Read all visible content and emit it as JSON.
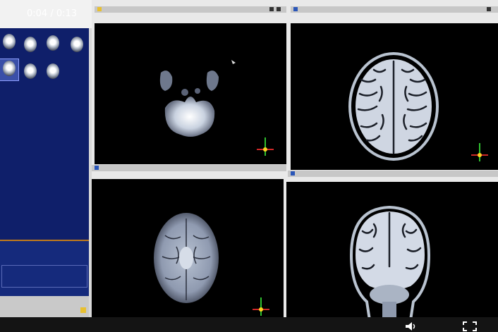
{
  "sidebar": {
    "title": "",
    "subtitle": "",
    "thumbnails": [
      {
        "label": "",
        "selected": false
      },
      {
        "label": "",
        "selected": false
      },
      {
        "label": "",
        "selected": false
      },
      {
        "label": "",
        "selected": false
      },
      {
        "label": "",
        "selected": true
      },
      {
        "label": "",
        "selected": false
      },
      {
        "label": "",
        "selected": false
      }
    ],
    "messages": {
      "line1": "",
      "line2": "",
      "line3": "",
      "box_text": ""
    }
  },
  "viewports": [
    {
      "id": "v1",
      "name": "axial-dwi-lower",
      "tag": ""
    },
    {
      "id": "v2",
      "name": "axial-t1-upper",
      "tag": ""
    },
    {
      "id": "v3",
      "name": "axial-dwi-mid",
      "tag": ""
    },
    {
      "id": "v4",
      "name": "coronal-t1",
      "tag": ""
    }
  ],
  "player": {
    "time": "0:04 / 0:13"
  },
  "colors": {
    "series_panel": "#0f1f6a",
    "viewport_bg": "#000000",
    "tag_blue": "#2a56b8",
    "accent_yellow": "#e8c030",
    "orient_x": "#d02828",
    "orient_y": "#2fc02f"
  },
  "icons": [
    "volume-icon",
    "fullscreen-icon",
    "orientation-marker-icon"
  ]
}
